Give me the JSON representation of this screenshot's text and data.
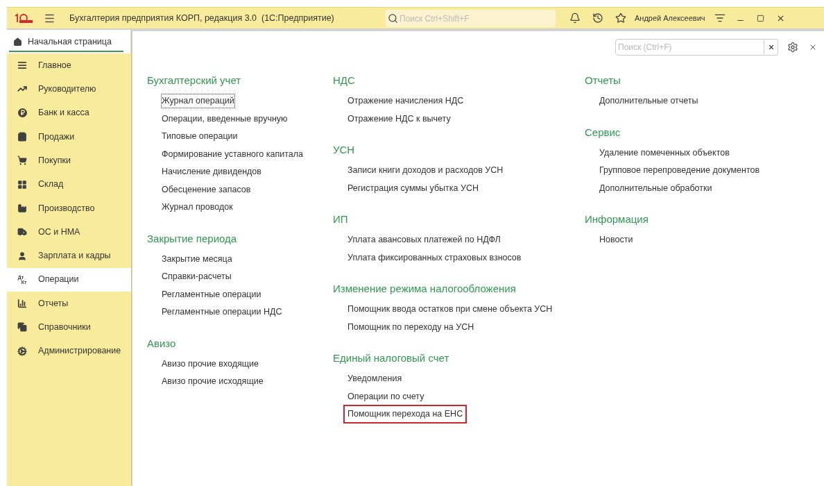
{
  "window": {
    "title": "Бухгалтерия предприятия КОРП, редакция 3.0  (1С:Предприятие)",
    "search_placeholder": "Поиск Ctrl+Shift+F",
    "user": "Андрей Алексеевич"
  },
  "home_tab": {
    "label": "Начальная страница",
    "selected": true
  },
  "sidebar": {
    "items": [
      {
        "label": "Главное",
        "selected": false
      },
      {
        "label": "Руководителю",
        "selected": false
      },
      {
        "label": "Банк и касса",
        "selected": false
      },
      {
        "label": "Продажи",
        "selected": false
      },
      {
        "label": "Покупки",
        "selected": false
      },
      {
        "label": "Склад",
        "selected": false
      },
      {
        "label": "Производство",
        "selected": false
      },
      {
        "label": "ОС и НМА",
        "selected": false
      },
      {
        "label": "Зарплата и кадры",
        "selected": false
      },
      {
        "label": "Операции",
        "icon_text_top": "Дт",
        "icon_text_bottom": "Кт",
        "selected": true
      },
      {
        "label": "Отчеты",
        "selected": false
      },
      {
        "label": "Справочники",
        "selected": false
      },
      {
        "label": "Администрирование",
        "selected": false
      }
    ]
  },
  "content": {
    "search_placeholder": "Поиск (Ctrl+F)",
    "columns": [
      [
        {
          "title": "Бухгалтерский учет",
          "links": [
            {
              "label": "Журнал операций",
              "focused": true,
              "highlighted": false
            },
            {
              "label": "Операции, введенные вручную",
              "focused": false,
              "highlighted": false
            },
            {
              "label": "Типовые операции",
              "focused": false,
              "highlighted": false
            },
            {
              "label": "Формирование уставного капитала",
              "focused": false,
              "highlighted": false
            },
            {
              "label": "Начисление дивидендов",
              "focused": false,
              "highlighted": false
            },
            {
              "label": "Обесценение запасов",
              "focused": false,
              "highlighted": false
            },
            {
              "label": "Журнал проводок",
              "focused": false,
              "highlighted": false
            }
          ]
        },
        {
          "title": "Закрытие периода",
          "links": [
            {
              "label": "Закрытие месяца",
              "focused": false,
              "highlighted": false
            },
            {
              "label": "Справки-расчеты",
              "focused": false,
              "highlighted": false
            },
            {
              "label": "Регламентные операции",
              "focused": false,
              "highlighted": false
            },
            {
              "label": "Регламентные операции НДС",
              "focused": false,
              "highlighted": false
            }
          ]
        },
        {
          "title": "Авизо",
          "links": [
            {
              "label": "Авизо прочие входящие",
              "focused": false,
              "highlighted": false
            },
            {
              "label": "Авизо прочие исходящие",
              "focused": false,
              "highlighted": false
            }
          ]
        }
      ],
      [
        {
          "title": "НДС",
          "links": [
            {
              "label": "Отражение начисления НДС",
              "focused": false,
              "highlighted": false
            },
            {
              "label": "Отражение НДС к вычету",
              "focused": false,
              "highlighted": false
            }
          ]
        },
        {
          "title": "УСН",
          "links": [
            {
              "label": "Записи книги доходов и расходов УСН",
              "focused": false,
              "highlighted": false
            },
            {
              "label": "Регистрация суммы убытка УСН",
              "focused": false,
              "highlighted": false
            }
          ]
        },
        {
          "title": "ИП",
          "links": [
            {
              "label": "Уплата авансовых платежей по НДФЛ",
              "focused": false,
              "highlighted": false
            },
            {
              "label": "Уплата фиксированных страховых взносов",
              "focused": false,
              "highlighted": false
            }
          ]
        },
        {
          "title": "Изменение режима налогообложения",
          "links": [
            {
              "label": "Помощник ввода остатков при смене объекта УСН",
              "focused": false,
              "highlighted": false
            },
            {
              "label": "Помощник по переходу на УСН",
              "focused": false,
              "highlighted": false
            }
          ]
        },
        {
          "title": "Единый налоговый счет",
          "links": [
            {
              "label": "Уведомления",
              "focused": false,
              "highlighted": false
            },
            {
              "label": "Операции по счету",
              "focused": false,
              "highlighted": false
            },
            {
              "label": "Помощник перехода на ЕНС",
              "focused": false,
              "highlighted": true
            }
          ]
        }
      ],
      [
        {
          "title": "Отчеты",
          "links": [
            {
              "label": "Дополнительные отчеты",
              "focused": false,
              "highlighted": false
            }
          ]
        },
        {
          "title": "Сервис",
          "links": [
            {
              "label": "Удаление помеченных объектов",
              "focused": false,
              "highlighted": false
            },
            {
              "label": "Групповое перепроведение документов",
              "focused": false,
              "highlighted": false
            },
            {
              "label": "Дополнительные обработки",
              "focused": false,
              "highlighted": false
            }
          ]
        },
        {
          "title": "Информация",
          "links": [
            {
              "label": "Новости",
              "focused": false,
              "highlighted": false
            }
          ]
        }
      ]
    ]
  }
}
